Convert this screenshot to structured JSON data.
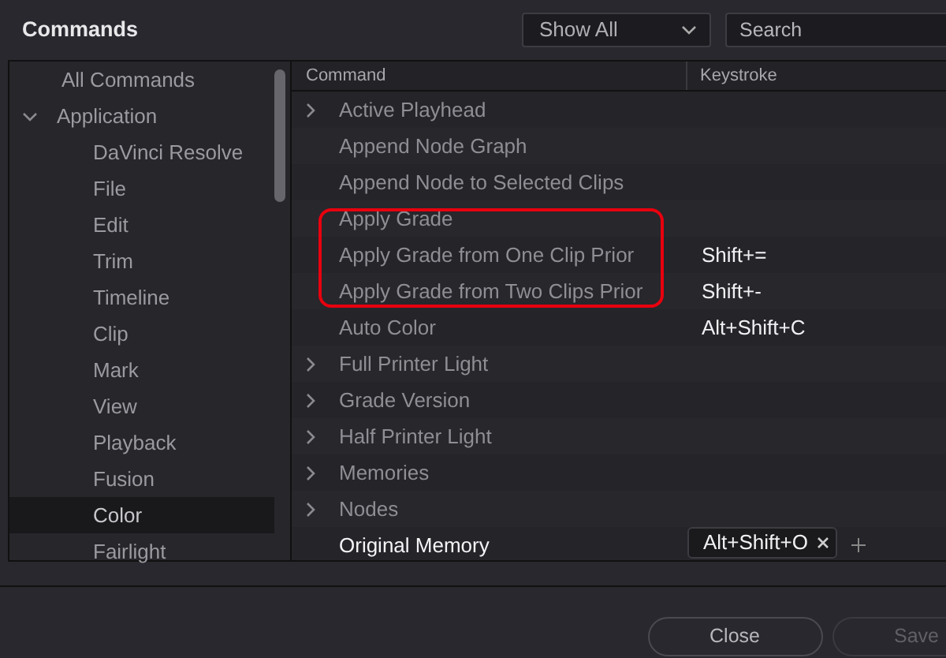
{
  "title": "Commands",
  "filter": {
    "value": "Show All"
  },
  "search": {
    "placeholder": "Search"
  },
  "sidebar": {
    "items": [
      {
        "label": "All Commands",
        "selected": false
      },
      {
        "label": "Application",
        "selected": false,
        "expanded": true,
        "children": [
          {
            "label": "DaVinci Resolve",
            "selected": false
          },
          {
            "label": "File",
            "selected": false
          },
          {
            "label": "Edit",
            "selected": false
          },
          {
            "label": "Trim",
            "selected": false
          },
          {
            "label": "Timeline",
            "selected": false
          },
          {
            "label": "Clip",
            "selected": false
          },
          {
            "label": "Mark",
            "selected": false
          },
          {
            "label": "View",
            "selected": false
          },
          {
            "label": "Playback",
            "selected": false
          },
          {
            "label": "Fusion",
            "selected": false
          },
          {
            "label": "Color",
            "selected": true
          },
          {
            "label": "Fairlight",
            "selected": false
          }
        ]
      }
    ]
  },
  "table": {
    "columns": [
      "Command",
      "Keystroke"
    ],
    "rows": [
      {
        "command": "Active Playhead",
        "expandable": true,
        "selected": false,
        "highlighted": false
      },
      {
        "command": "Append Node Graph",
        "expandable": false,
        "selected": false,
        "highlighted": false
      },
      {
        "command": "Append Node to Selected Clips",
        "expandable": false,
        "selected": false,
        "highlighted": false
      },
      {
        "command": "Apply Grade",
        "expandable": false,
        "selected": false,
        "highlighted": true
      },
      {
        "command": "Apply Grade from One Clip Prior",
        "keystroke": "Shift+=",
        "expandable": false,
        "selected": false,
        "highlighted": true
      },
      {
        "command": "Apply Grade from Two Clips Prior",
        "keystroke": "Shift+-",
        "expandable": false,
        "selected": false,
        "highlighted": true
      },
      {
        "command": "Auto Color",
        "keystroke": "Alt+Shift+C",
        "expandable": false,
        "selected": false,
        "highlighted": false
      },
      {
        "command": "Full Printer Light",
        "expandable": true,
        "selected": false,
        "highlighted": false
      },
      {
        "command": "Grade Version",
        "expandable": true,
        "selected": false,
        "highlighted": false
      },
      {
        "command": "Half Printer Light",
        "expandable": true,
        "selected": false,
        "highlighted": false
      },
      {
        "command": "Memories",
        "expandable": true,
        "selected": false,
        "highlighted": false
      },
      {
        "command": "Nodes",
        "expandable": true,
        "selected": false,
        "highlighted": false
      },
      {
        "command": "Original Memory",
        "keystroke": "Alt+Shift+O",
        "expandable": false,
        "selected": true,
        "highlighted": false,
        "editing": true
      }
    ]
  },
  "buttons": [
    {
      "label": "Close",
      "disabled": false
    },
    {
      "label": "Save",
      "disabled": true
    }
  ]
}
